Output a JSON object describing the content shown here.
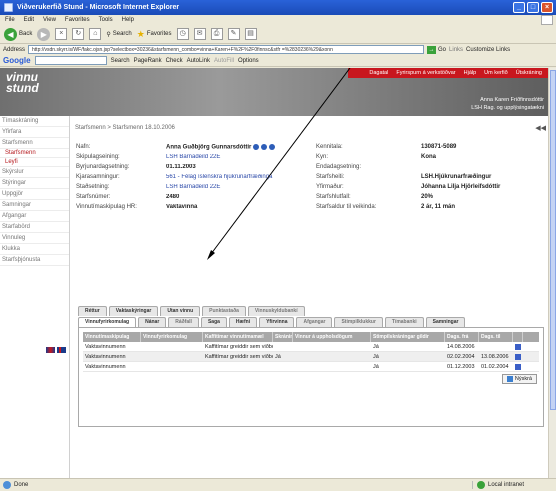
{
  "window": {
    "title": "Viðverukerfið Stund - Microsoft Internet Explorer"
  },
  "menu": [
    "File",
    "Edit",
    "View",
    "Favorites",
    "Tools",
    "Help"
  ],
  "toolbar": {
    "back": "Back",
    "search": "Search",
    "favorites": "Favorites"
  },
  "address": {
    "label": "Address",
    "url": "http://vsdn.skyrr.is/WF/fakc.ojsn.jsp?selectbox=30236&starfsmenn_combo=vinna+Karen+F%2F%2F0finnsc&stfr =%2830236%29&xonn",
    "go": "Go",
    "links": "Links",
    "customize": "Customize Links"
  },
  "google": {
    "logo": "Google",
    "search": "Search",
    "pagerank": "PageRank",
    "check": "Check",
    "autolink": "AutoLink",
    "autofill": "AutoFill",
    "options": "Options"
  },
  "banner": {
    "logo_line1": "vinnu",
    "logo_line2": "stund",
    "links": [
      "Dagatal",
      "Fyrirspurn á verkstöðvar",
      "Hjálp",
      "Um kerfið",
      "Útskráning"
    ],
    "user_name": "Anna Karen Friðfinnsdóttir",
    "user_org": "LSH Rag. og upplýsingatækni"
  },
  "sidebar": {
    "items": [
      "Tímaskráning",
      "Yfirfara",
      "Starfsmenn",
      "Starfsmenn",
      "Leyfi",
      "Skýrslur",
      "Stýringar",
      "Uppgjör",
      "Samningar",
      "Afgangar",
      "Starfabörd",
      "Vinnuleg",
      "Klukka",
      "Starfsþjónusta"
    ]
  },
  "breadcrumb": "Starfsmenn > Starfsmenn 18.10.2006",
  "employee": {
    "rows": [
      {
        "l": "Nafn:",
        "v": "Anna Guðbjörg Gunnarsdóttir",
        "l2": "Kennitala:",
        "v2": "130871-5089"
      },
      {
        "l": "Skipulagseining:",
        "v": "LSH Barnadeild 22E",
        "l2": "Kyn:",
        "v2": "Kona"
      },
      {
        "l": "Byrjunardagsetning:",
        "v": "01.11.2003",
        "l2": "Endadagsetning:",
        "v2": ""
      },
      {
        "l": "Kjarasamningur:",
        "v": "561 - Félag íslenskra hjúkrunarfræðinga",
        "l2": "Starfsheiti:",
        "v2": "LSH.Hjúkrunarfræðingur"
      },
      {
        "l": "Staðsetning:",
        "v": "LSH Barnadeild 22E",
        "l2": "Yfirmaður:",
        "v2": "Jóhanna Lilja Hjörleifsdóttir"
      },
      {
        "l": "Starfsnúmer:",
        "v": "2480",
        "l2": "Starfshlutfall:",
        "v2": "20%"
      },
      {
        "l": "Vinnutímaskipulag HR:",
        "v": "Vaktavinna",
        "l2": "Starfsaldur til veikinda:",
        "v2": "2 ár, 11 mán"
      }
    ]
  },
  "tabs_row1": [
    "Réttur",
    "Vaktaskýringar",
    "Utan vinnu",
    "Punktastaða",
    "Vinnuskyldubankí"
  ],
  "tabs_row2": [
    "Vinnufyrirkomulag",
    "Nánar",
    "Ráðfall",
    "Saga",
    "Hæfni",
    "Yfirvinna",
    "Afgangar",
    "Stimpilklukkur",
    "Tímabanki",
    "Samningar"
  ],
  "grid": {
    "headers": [
      "Vinnutímaskipulag",
      "Vinnufyrirkomulag",
      "Kaffitímar vinnutímamæl",
      "Skráning",
      "Vinnur á uppholsdögum",
      "Stimpilskráningar gildir",
      "Dags. frá",
      "Dags. til",
      ""
    ],
    "rows": [
      [
        "Vaktavinnumenn",
        "",
        "Kaffitímar greiddir sem viðbót",
        "",
        "",
        "Já",
        "14.08.2006",
        "",
        ""
      ],
      [
        "Vaktavinnumenn",
        "",
        "Kaffitímar greiddir sem viðbót",
        "Já",
        "",
        "Já",
        "02.02.2004",
        "13.08.2006",
        ""
      ],
      [
        "Vaktavinnumenn",
        "",
        "",
        "",
        "",
        "Já",
        "01.12.2003",
        "01.02.2004",
        ""
      ]
    ],
    "add_label": "Nýskrá"
  },
  "status": {
    "text": "Done",
    "zone": "Local intranet"
  },
  "colors": {
    "brand_red": "#c8171e",
    "link_blue": "#2a48a8"
  }
}
